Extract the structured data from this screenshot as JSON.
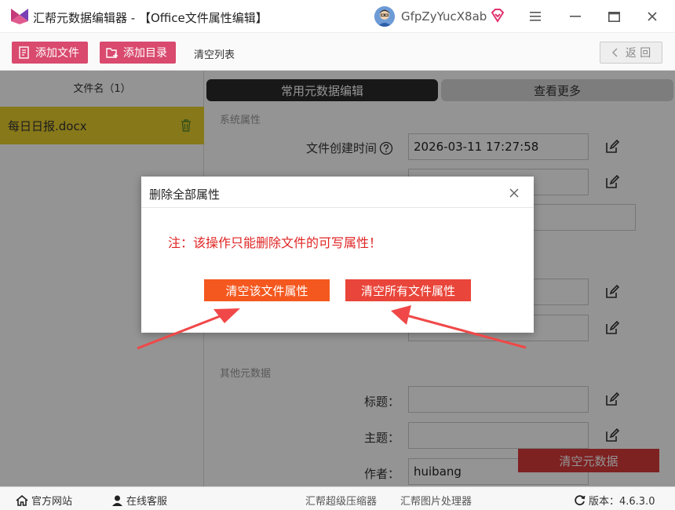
{
  "title_bar": {
    "app_title": "汇帮元数据编辑器 - 【Office文件属性编辑】",
    "username": "GfpZyYucX8ab"
  },
  "toolbar": {
    "add_file": "添加文件",
    "add_dir": "添加目录",
    "clear_list": "清空列表",
    "back": "返 回"
  },
  "file_list": {
    "header": "文件名（1）",
    "files": [
      "每日日报.docx"
    ]
  },
  "tabs": {
    "active": "常用元数据编辑",
    "more": "查看更多"
  },
  "sections": {
    "system": "系统属性",
    "other": "其他元数据"
  },
  "fields": {
    "created_label": "文件创建时间",
    "created_value": "2026-03-11 17:27:58",
    "title_label": "标题：",
    "subject_label": "主题：",
    "author_label": "作者：",
    "author_value": "huibang"
  },
  "clear_meta": "清空元数据",
  "status_bar": {
    "website": "官方网站",
    "support": "在线客服",
    "compressor": "汇帮超级压缩器",
    "image_tool": "汇帮图片处理器",
    "version": "版本：4.6.3.0"
  },
  "dialog": {
    "title": "删除全部属性",
    "message": "注：该操作只能删除文件的可写属性！",
    "clear_this": "清空该文件属性",
    "clear_all": "清空所有文件属性"
  },
  "colors": {
    "accent_pink": "#d94a6e",
    "selected_file": "#e9cf2e",
    "warning_red": "#e02424",
    "btn_orange": "#f4581f",
    "btn_red": "#e9453a"
  }
}
